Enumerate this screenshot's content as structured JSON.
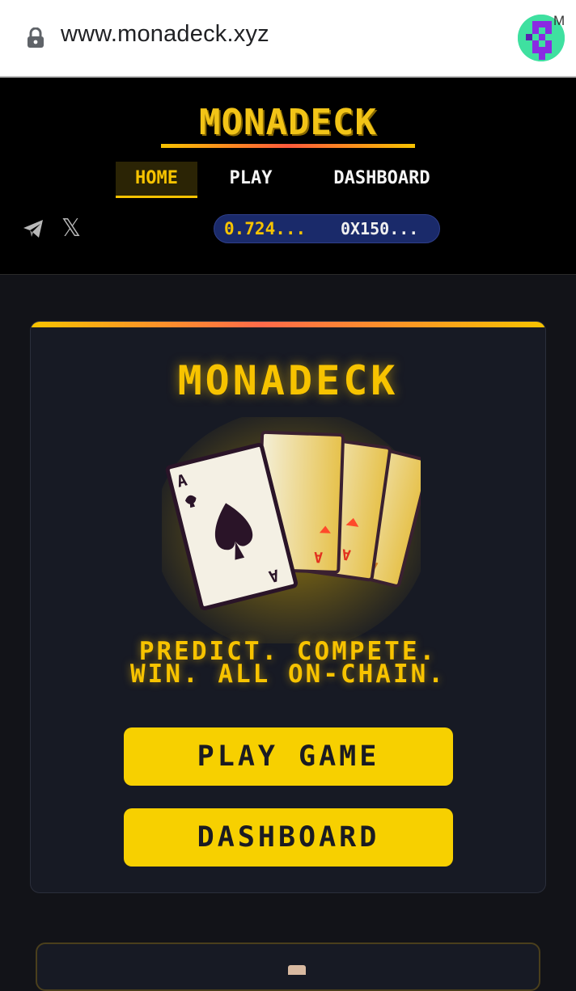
{
  "browser": {
    "url": "www.monadeck.xyz",
    "extension_badge": "M"
  },
  "header": {
    "logo": "MONADECK",
    "nav": [
      {
        "label": "HOME",
        "active": true
      },
      {
        "label": "PLAY",
        "active": false
      },
      {
        "label": "DASHBOARD",
        "active": false
      }
    ],
    "social_icons": [
      "telegram-icon",
      "x-icon"
    ],
    "x_glyph": "𝕏",
    "wallet": {
      "balance": "0.724...",
      "address": "0X150..."
    }
  },
  "hero": {
    "title": "MONADECK",
    "tagline_line1": "PREDICT. COMPETE.",
    "tagline_line2": "WIN. ALL ON-CHAIN.",
    "play_button": "PLAY GAME",
    "dashboard_button": "DASHBOARD",
    "card_rank": "A"
  },
  "colors": {
    "accent": "#f7c300",
    "background": "#121318",
    "card": "#171a24"
  }
}
